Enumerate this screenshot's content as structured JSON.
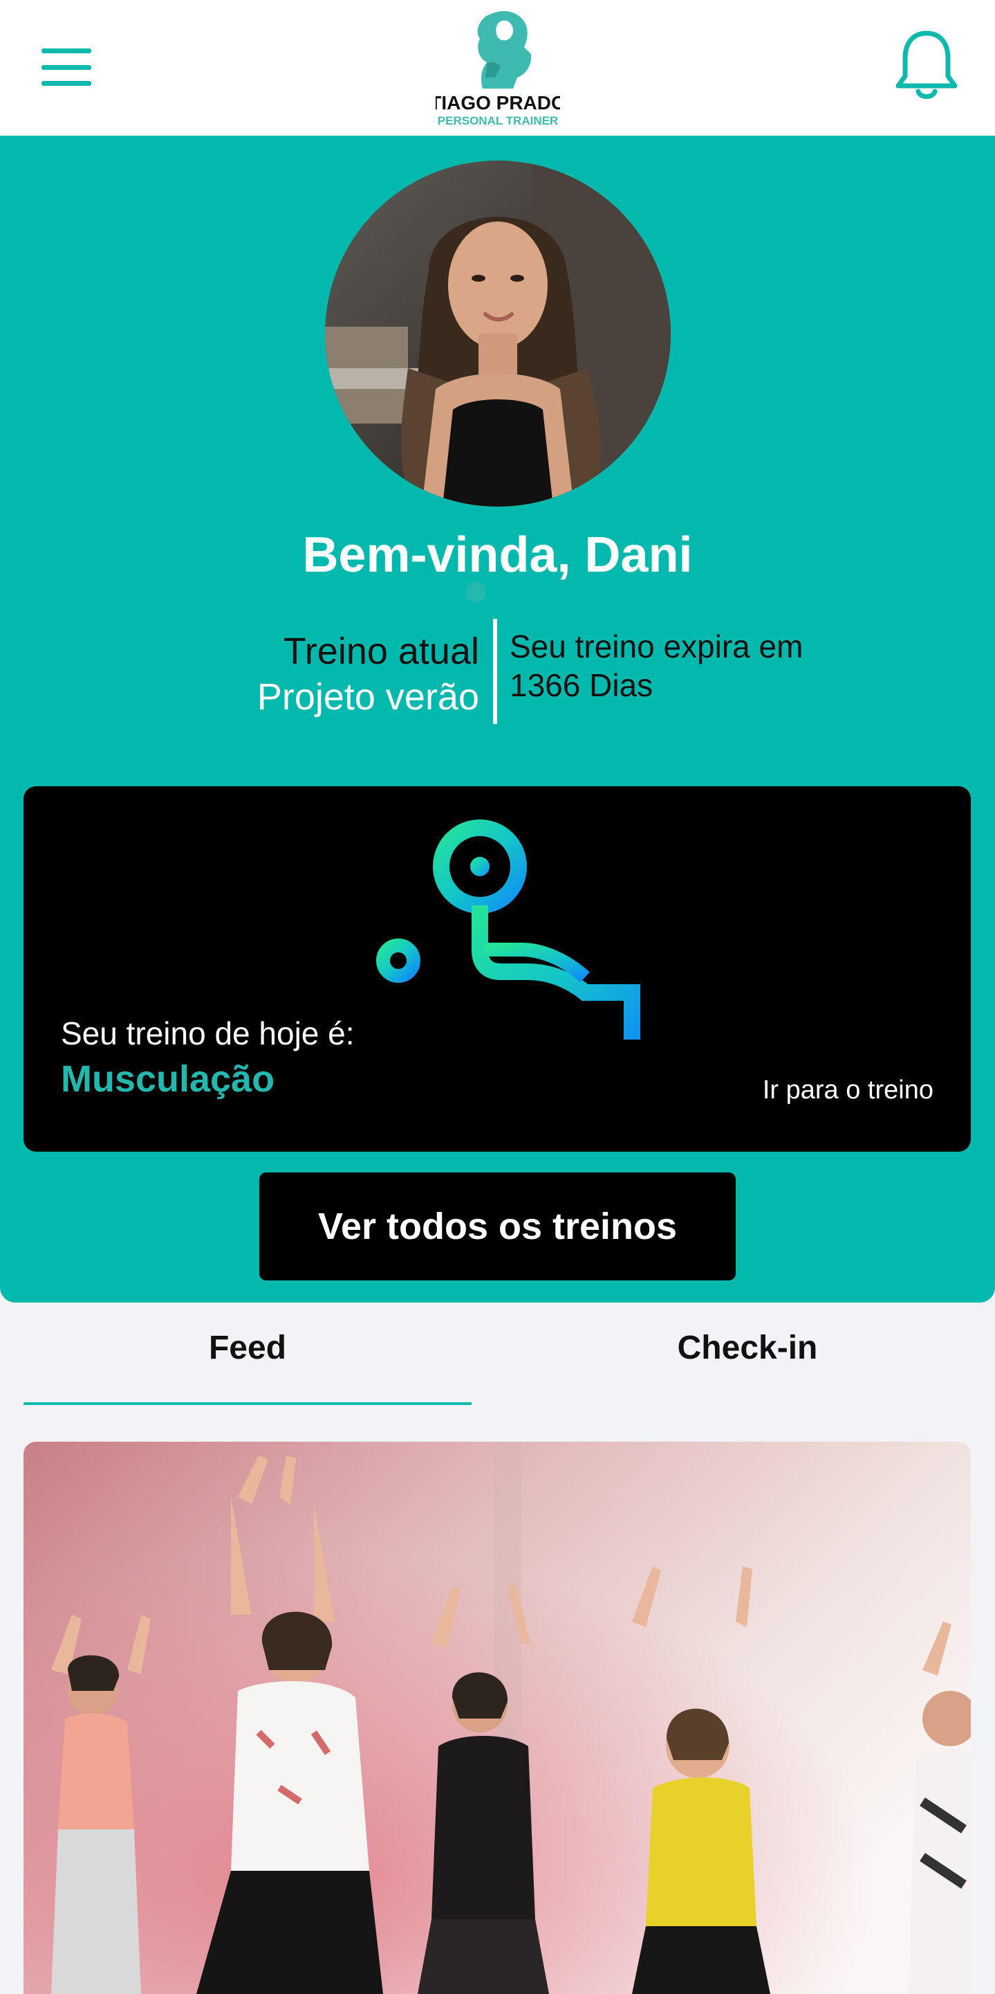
{
  "header": {
    "logo_title": "TIAGO PRADO",
    "logo_subtitle": "PERSONAL TRAINER",
    "menu_icon": "hamburger-menu-icon",
    "notification_icon": "bell-icon"
  },
  "profile": {
    "welcome": "Bem-vinda, Dani",
    "current_plan_label": "Treino atual",
    "current_plan_name": "Projeto verão",
    "expires_label": "Seu treino expira em",
    "expires_value": "1366 Dias"
  },
  "today_workout": {
    "label": "Seu treino de hoje é:",
    "name": "Musculação",
    "link": "Ir para o treino",
    "icon": "weightlifting-icon"
  },
  "all_workouts_button": "Ver todos os treinos",
  "tabs": [
    {
      "label": "Feed",
      "active": true
    },
    {
      "label": "Check-in",
      "active": false
    }
  ],
  "colors": {
    "brand": "#03b9ae",
    "accent_text": "#22b8ae",
    "card_bg": "#000000"
  }
}
